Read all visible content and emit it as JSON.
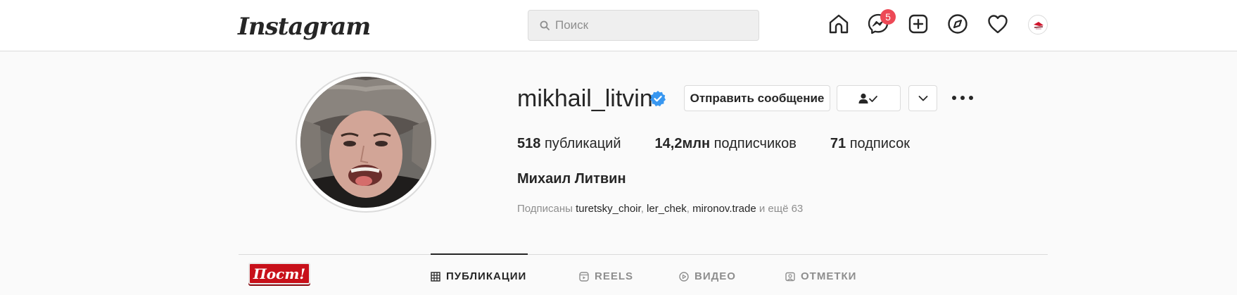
{
  "nav": {
    "logo": "Instagram",
    "search_placeholder": "Поиск",
    "messenger_badge": "5",
    "icons": [
      "home-icon",
      "messenger-icon",
      "new-post-icon",
      "explore-icon",
      "activity-heart-icon",
      "profile-avatar"
    ]
  },
  "profile": {
    "username": "mikhail_litvin",
    "verified": true,
    "buttons": {
      "message": "Отправить сообщение"
    },
    "stats": [
      {
        "value": "518",
        "label": "публикаций"
      },
      {
        "value": "14,2млн",
        "label": "подписчиков"
      },
      {
        "value": "71",
        "label": "подписок"
      }
    ],
    "full_name": "Михаил Литвин",
    "followed_by": {
      "prefix": "Подписаны",
      "accounts": [
        "turetsky_choir",
        "ler_chek",
        "mironov.trade"
      ],
      "suffix": "и ещё 63"
    }
  },
  "tabs": [
    {
      "label": "ПУБЛИКАЦИИ",
      "active": true
    },
    {
      "label": "REELS",
      "active": false
    },
    {
      "label": "ВИДЕО",
      "active": false
    },
    {
      "label": "ОТМЕТКИ",
      "active": false
    }
  ],
  "sticker": {
    "text": "Пост!"
  },
  "colors": {
    "verified_blue": "#3897f0",
    "badge_red": "#ed4956",
    "sticker_red": "#c8101a",
    "text": "#262626",
    "muted": "#8e8e8e"
  }
}
